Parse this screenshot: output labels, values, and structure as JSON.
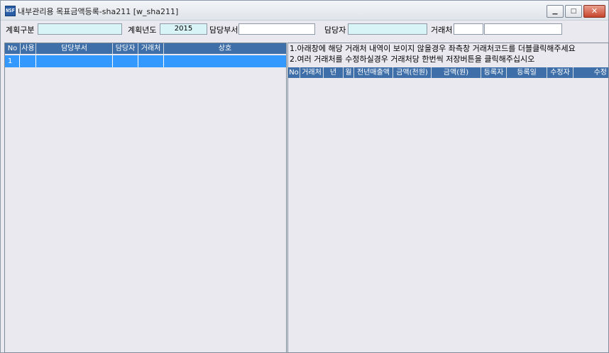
{
  "window": {
    "icon_text": "NSF",
    "title": "내부관리용 목표금액등록-sha211 [w_sha211]",
    "minimize_glyph": "▁",
    "maximize_glyph": "□",
    "close_glyph": "✕"
  },
  "filters": {
    "plan_type_label": "계획구분",
    "plan_type_value": "",
    "plan_year_label": "계획년도",
    "plan_year_value": "2015",
    "department_label": "담당부서",
    "department_value": "",
    "manager_label": "담당자",
    "manager_value": "",
    "client_label": "거래처",
    "client_code_value": "",
    "client_name_value": ""
  },
  "left_grid": {
    "columns": [
      "No",
      "사용",
      "담당부서",
      "담당자",
      "거래처",
      "상호"
    ],
    "rows": [
      {
        "no": "1",
        "use": "",
        "department": "",
        "manager": "",
        "client": "",
        "company": ""
      }
    ]
  },
  "right_panel": {
    "notice_1": "1.아래창에 해당 거래처 내역이 보이지 않을경우 좌측창 거래처코드를 더블클릭해주세요",
    "notice_2": "2.여러 거래처를 수정하실경우 거래처당 한번씩 저장버튼을 클릭해주십시오",
    "columns": [
      "No",
      "거래처",
      "년",
      "월",
      "전년매출액",
      "금액(천원)",
      "금액(원)",
      "등록자",
      "등록일",
      "수정자",
      "수정"
    ]
  },
  "colors": {
    "header_bg": "#3f6fa8",
    "selected_row": "#3399ff",
    "input_cyan": "#d9f4f6",
    "window_bg": "#e9e9ef"
  }
}
